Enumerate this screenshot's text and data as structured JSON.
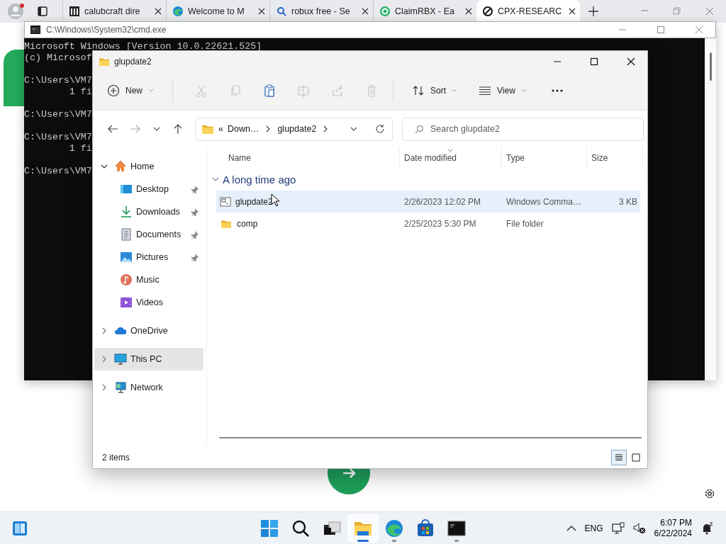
{
  "browser": {
    "tabs": [
      {
        "title": "calubcraft dire",
        "selected": false
      },
      {
        "title": "Welcome to M",
        "selected": false
      },
      {
        "title": "robux free - Se",
        "selected": false
      },
      {
        "title": "ClaimRBX - Ea",
        "selected": false
      },
      {
        "title": "CPX-RESEARC",
        "selected": true
      }
    ]
  },
  "console": {
    "title": "C:\\Windows\\System32\\cmd.exe",
    "blocks": [
      [
        "Microsoft Windows [Version 10.0.22621.525]",
        "(c) Microsof"
      ],
      [
        "C:\\Users\\VM7",
        "        1 fi"
      ],
      [
        "C:\\Users\\VM7"
      ],
      [
        "C:\\Users\\VM7",
        "        1 fi"
      ],
      [
        "C:\\Users\\VM7"
      ]
    ]
  },
  "explorer": {
    "title": "glupdate2",
    "new_label": "New",
    "commands": [
      {
        "kind": "cut",
        "disabled": true
      },
      {
        "kind": "copy",
        "disabled": true
      },
      {
        "kind": "paste",
        "disabled": false
      },
      {
        "kind": "rename",
        "disabled": true
      },
      {
        "kind": "share",
        "disabled": true
      },
      {
        "kind": "delete",
        "disabled": true
      }
    ],
    "sort_label": "Sort",
    "view_label": "View",
    "address": {
      "overflow": "«",
      "crumbs": [
        "Down…",
        "glupdate2"
      ]
    },
    "search": {
      "placeholder": "Search glupdate2"
    },
    "nav": [
      {
        "label": "Home",
        "expanded": true,
        "selected": false,
        "children": [
          {
            "label": "Desktop",
            "pinned": true,
            "selected": false
          },
          {
            "label": "Downloads",
            "pinned": true,
            "selected": false
          },
          {
            "label": "Documents",
            "pinned": true,
            "selected": false
          },
          {
            "label": "Pictures",
            "pinned": true,
            "selected": false
          },
          {
            "label": "Music",
            "pinned": false,
            "selected": false
          },
          {
            "label": "Videos",
            "pinned": false,
            "selected": false
          }
        ]
      },
      {
        "label": "OneDrive",
        "expanded": false,
        "selected": false
      },
      {
        "label": "This PC",
        "expanded": false,
        "selected": true
      },
      {
        "label": "Network",
        "expanded": false,
        "selected": false
      }
    ],
    "columns": [
      {
        "label": "Name",
        "sorted": false
      },
      {
        "label": "Date modified",
        "sorted": true
      },
      {
        "label": "Type",
        "sorted": false
      },
      {
        "label": "Size",
        "sorted": false
      }
    ],
    "groups": [
      {
        "label": "A long time ago",
        "expanded": true,
        "rows": [
          {
            "kind": "script",
            "name": "glupdate2",
            "date": "2/26/2023 12:02 PM",
            "type": "Windows Comma…",
            "size": "3 KB",
            "selected": true
          },
          {
            "kind": "folder",
            "name": "comp",
            "date": "2/25/2023 5:30 PM",
            "type": "File folder",
            "selected": false
          }
        ]
      }
    ],
    "status": "2 items",
    "view_modes": [
      {
        "kind": "details",
        "selected": true
      },
      {
        "kind": "tiles",
        "selected": false
      }
    ]
  },
  "taskbar": {
    "apps": [
      {
        "kind": "start",
        "running": false,
        "active": false
      },
      {
        "kind": "search",
        "running": false,
        "active": false
      },
      {
        "kind": "task-view",
        "running": false,
        "active": false
      },
      {
        "kind": "explorer",
        "running": true,
        "active": true
      },
      {
        "kind": "edge",
        "running": true,
        "active": false
      },
      {
        "kind": "store",
        "running": false,
        "active": false
      },
      {
        "kind": "terminal",
        "running": true,
        "active": false
      }
    ],
    "language": "ENG",
    "time": "6:07 PM",
    "date": "6/22/2024"
  }
}
